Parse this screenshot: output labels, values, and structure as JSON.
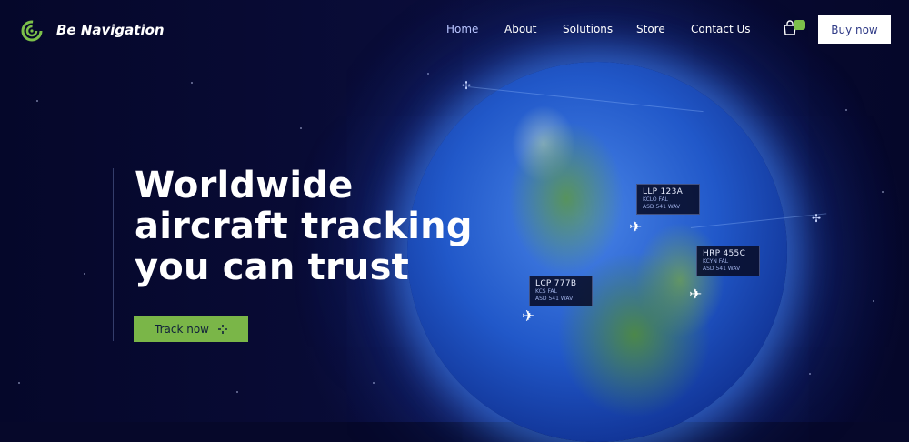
{
  "header": {
    "brand": "Be Navigation",
    "nav": [
      {
        "label": "Home",
        "active": true
      },
      {
        "label": "About"
      },
      {
        "label": "Solutions"
      },
      {
        "label": "Store"
      },
      {
        "label": "Contact Us"
      }
    ],
    "buy_label": "Buy now"
  },
  "hero": {
    "title_lines": [
      "Worldwide",
      "aircraft tracking",
      "you can trust"
    ],
    "cta_label": "Track now"
  },
  "flights": [
    {
      "code": "LLP 123A",
      "line1": "KCLO FAL",
      "line2": "ASD 541 WAV"
    },
    {
      "code": "HRP 455C",
      "line1": "KCYN FAL",
      "line2": "ASD 541 WAV"
    },
    {
      "code": "LCP 777B",
      "line1": "KCS FAL",
      "line2": "ASD 541 WAV"
    }
  ],
  "colors": {
    "accent": "#7ab648",
    "background": "#06082a",
    "nav_active": "#b8c4ff"
  },
  "icons": [
    "logo-icon",
    "cart-icon",
    "crosshair-icon",
    "plane-icon",
    "satellite-icon"
  ]
}
